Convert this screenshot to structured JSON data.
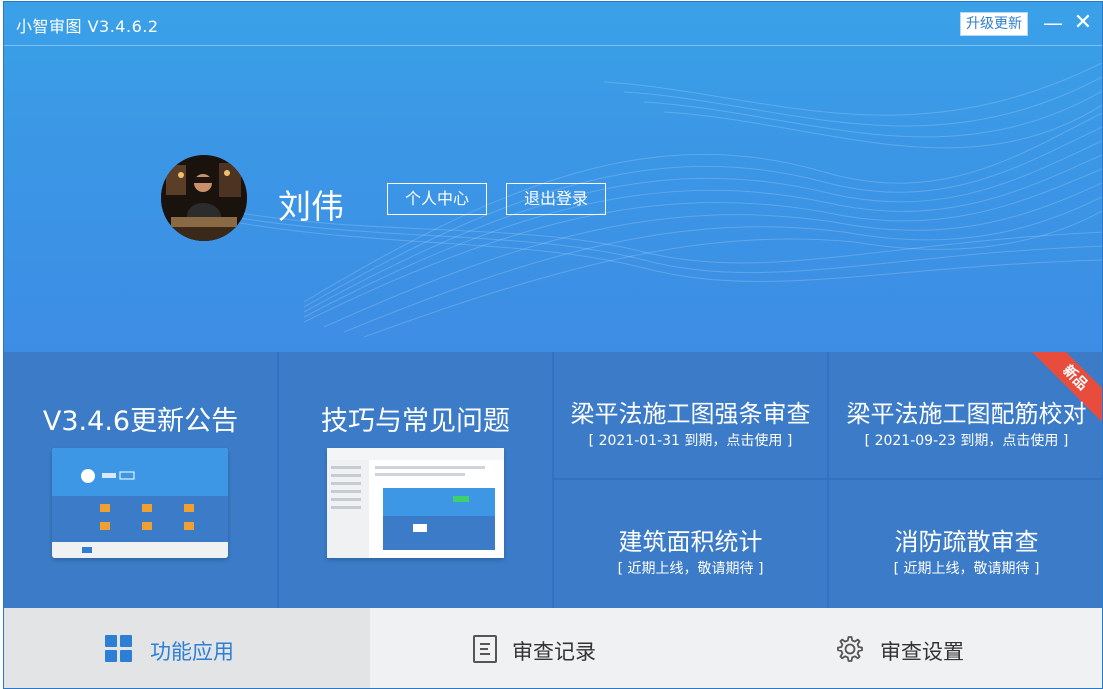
{
  "window": {
    "title": "小智审图 V3.4.6.2",
    "upgrade_label": "升级更新",
    "minimize_symbol": "—",
    "close_symbol": "✕"
  },
  "user": {
    "name": "刘伟",
    "personal_center_label": "个人中心",
    "logout_label": "退出登录"
  },
  "tiles": {
    "update_notice": {
      "title": "V3.4.6更新公告"
    },
    "tips_faq": {
      "title": "技巧与常见问题"
    },
    "beam_mandatory": {
      "title": "梁平法施工图强条审查",
      "sub": "[ 2021-01-31 到期，点击使用 ]"
    },
    "beam_rebar": {
      "title": "梁平法施工图配筋校对",
      "sub": "[ 2021-09-23 到期，点击使用 ]",
      "badge": "新品"
    },
    "area_stats": {
      "title": "建筑面积统计",
      "sub": "[ 近期上线，敬请期待 ]"
    },
    "fire_evac": {
      "title": "消防疏散审查",
      "sub": "[ 近期上线，敬请期待 ]"
    }
  },
  "nav": [
    {
      "label": "功能应用",
      "icon": "grid-icon",
      "active": true
    },
    {
      "label": "审查记录",
      "icon": "document-icon",
      "active": false
    },
    {
      "label": "审查设置",
      "icon": "gear-icon",
      "active": false
    }
  ],
  "colors": {
    "header": "#3b97e6",
    "tile": "#3c7bc7",
    "ribbon": "#e84c3d",
    "accent": "#2d7fd6",
    "nav_bg": "#f0f1f3"
  }
}
